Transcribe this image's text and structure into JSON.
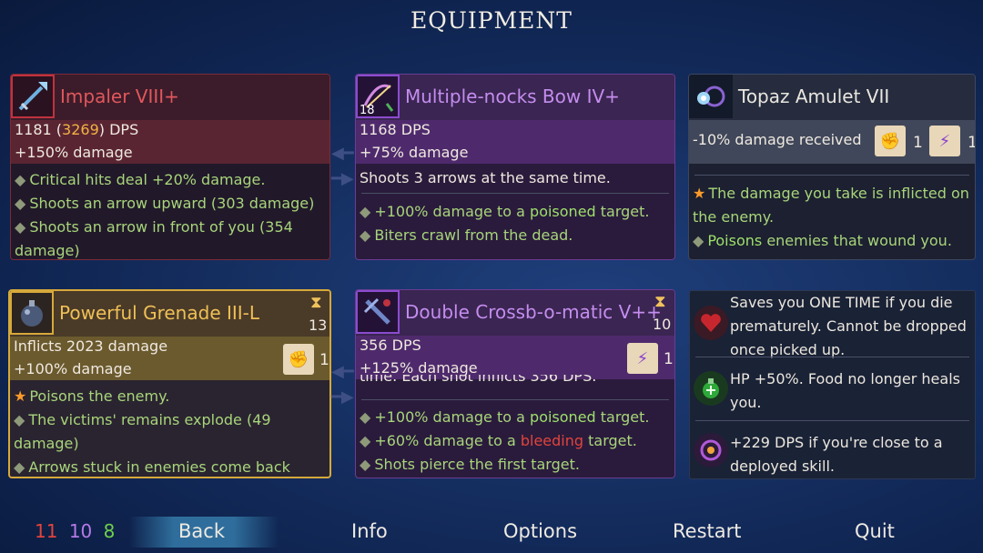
{
  "title": "EQUIPMENT",
  "weapon1": {
    "name": "Impaler VIII+",
    "dps_base": "1181 (",
    "dps_alt": "3269",
    "dps_suffix": ") DPS",
    "bonus": "+150% damage",
    "effects": [
      "Critical hits deal +20% damage.",
      "Shoots an arrow upward (303 damage)",
      "Shoots an arrow in front of you (354",
      "damage)"
    ]
  },
  "weapon2": {
    "name": "Multiple-nocks Bow IV+",
    "level": "18",
    "dps": "1168 DPS",
    "bonus": "+75% damage",
    "desc": "Shoots 3 arrows at the same time.",
    "effect1_pre": "+100% damage to a ",
    "effect1_hl": "poisoned",
    "effect1_post": " target.",
    "effect2": "Biters crawl from the dead."
  },
  "amulet": {
    "name": "Topaz Amulet VII",
    "stat": "-10% damage received",
    "scroll1_count": "1",
    "scroll2_count": "1",
    "effect1": "The damage you take is inflicted on",
    "effect1b": "the enemy.",
    "effect2_hl": "Poisons",
    "effect2_post": " enemies that wound you."
  },
  "skill1": {
    "name": "Powerful Grenade III-L",
    "cooldown": "13",
    "damage": "Inflicts 2023 damage",
    "bonus": "+100% damage",
    "scroll_count": "1",
    "effect1": "Poisons the enemy.",
    "effect2": "The victims' remains explode (49",
    "effect2b": "damage)",
    "effect3": "Arrows stuck in enemies come back"
  },
  "skill2": {
    "name": "Double Crossb-o-matic V++",
    "cooldown": "10",
    "dps": "356 DPS",
    "bonus": "+125% damage",
    "scroll_count": "1",
    "cut_text": "time. Each shot inflicts 356 DPS.",
    "effect1_pre": "+100% damage to a ",
    "effect1_hl": "poisoned",
    "effect1_post": " target.",
    "effect2_pre": "+60% damage to a ",
    "effect2_hl": "bleeding",
    "effect2_post": " target.",
    "effect3": "Shots pierce the first target."
  },
  "mutations": [
    {
      "icon": "heart-icon",
      "lines": [
        "Saves you ONE TIME if you die",
        "prematurely. Cannot be dropped",
        "once picked up."
      ]
    },
    {
      "icon": "potion-icon",
      "lines": [
        "HP +50%. Food no longer heals",
        "you."
      ]
    },
    {
      "icon": "eye-icon",
      "lines": [
        "+229 DPS if you're close to a",
        "deployed skill."
      ]
    }
  ],
  "gems": {
    "red": "11",
    "purple": "10",
    "green": "8"
  },
  "menu": {
    "back": "Back",
    "info": "Info",
    "options": "Options",
    "restart": "Restart",
    "quit": "Quit"
  },
  "colors": {
    "red": "#e0443c",
    "purple": "#b57ae8",
    "green": "#6fd04a",
    "gold": "#efc056"
  }
}
